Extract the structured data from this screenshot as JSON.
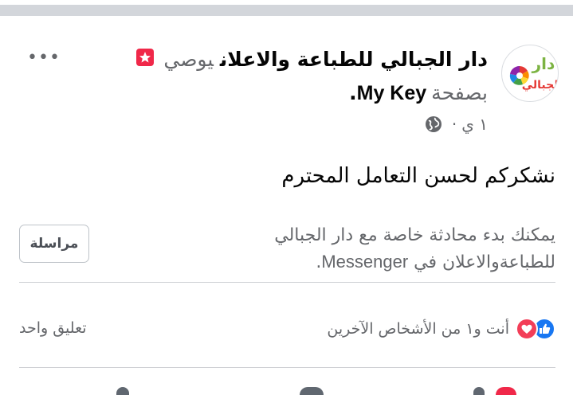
{
  "post": {
    "author": "دار الجبالي للطباعة والاعلان",
    "verb": "يوصي",
    "on_page_prefix": "بصفحة",
    "page_name": "My Key",
    "period": ".",
    "time": "١ ي",
    "separator": "·",
    "more_label": "•••",
    "body": "نشكركم لحسن التعامل المحترم"
  },
  "messenger": {
    "line1": "يمكنك بدء محادثة خاصة مع دار الجبالي",
    "line2_ar": "للطباعةوالاعلان في",
    "line2_brand": "Messenger",
    "line2_end": ".",
    "button_label": "مراسلة"
  },
  "footer": {
    "reactions_text": "أنت و١ من الأشخاص الآخرين",
    "comments_text": "تعليق واحد"
  },
  "avatar": {
    "text_top": "دار",
    "text_bottom": "الجبالي"
  },
  "colors": {
    "like_blue": "#1877f2",
    "love_red": "#f33e58",
    "recommend_badge": "#f02849",
    "secondary_text": "#65676b",
    "divider": "#ced0d4"
  },
  "icons": {
    "recommend": "star-badge-icon",
    "privacy": "globe-icon",
    "like": "like-icon",
    "love": "love-icon",
    "more": "more-options-icon"
  }
}
